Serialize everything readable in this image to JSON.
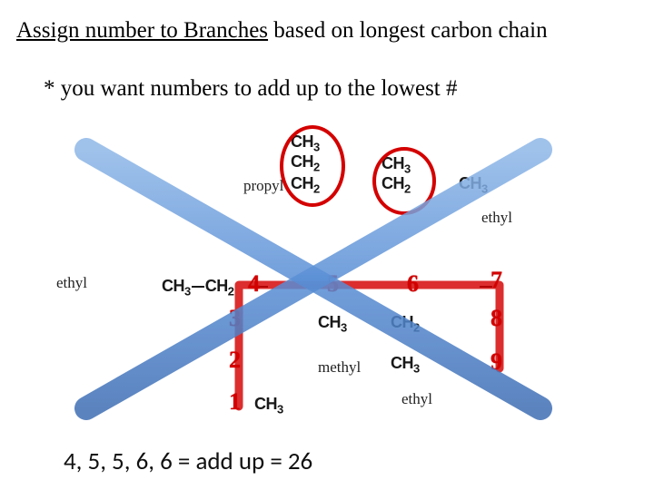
{
  "heading": {
    "underlined": "Assign number to Branches",
    "rest": " based on longest carbon chain"
  },
  "subnote": "* you want numbers to add up to the lowest #",
  "labels": {
    "ethyl_left": "ethyl",
    "propyl": "propyl",
    "ethyl_right": "ethyl",
    "methyl": "methyl",
    "ethyl_bottom": "ethyl"
  },
  "chem": {
    "CH3": "CH",
    "CH2": "CH",
    "sub3": "3",
    "sub2": "2",
    "mainLeft": "CH",
    "mainLeft2": "CH"
  },
  "numbers": {
    "n1": "1",
    "n2": "2",
    "n3": "3",
    "n4": "4",
    "n5": "5",
    "n6": "6",
    "n7": "7",
    "n8": "8",
    "n9": "9"
  },
  "sum_line": "4, 5, 5, 6, 6 = add up = 26"
}
